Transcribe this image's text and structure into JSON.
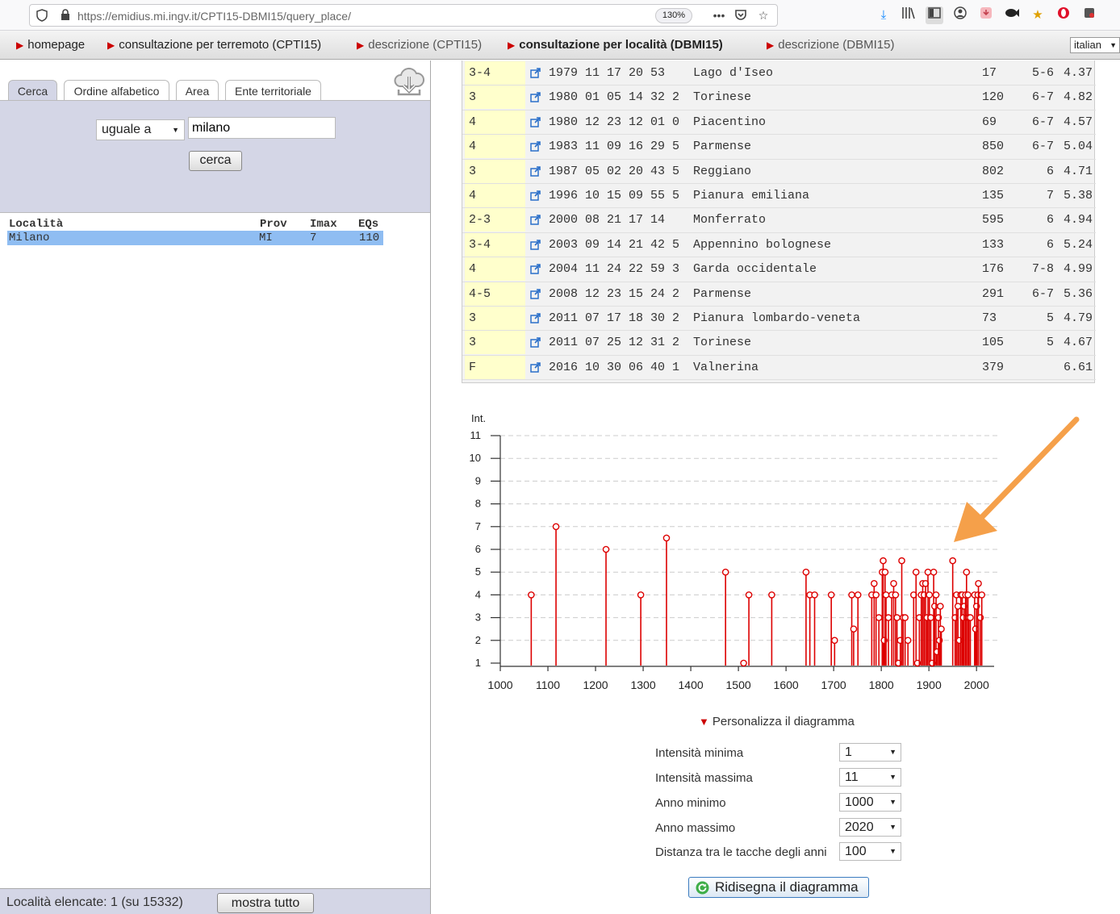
{
  "browser": {
    "url": "https://emidius.mi.ingv.it/CPTI15-DBMI15/query_place/",
    "zoom": "130%"
  },
  "nav": {
    "items": [
      {
        "label": "homepage"
      },
      {
        "label": "consultazione per terremoto (CPTI15)"
      },
      {
        "label": "descrizione (CPTI15)"
      },
      {
        "label": "consultazione per località (DBMI15)"
      },
      {
        "label": "descrizione (DBMI15)"
      }
    ],
    "language": "italian"
  },
  "tabs": [
    "Cerca",
    "Ordine alfabetico",
    "Area",
    "Ente territoriale"
  ],
  "search": {
    "match_mode": "uguale a",
    "query": "milano",
    "button": "cerca"
  },
  "locations": {
    "headers": [
      "Località",
      "Prov",
      "Imax",
      "EQs"
    ],
    "rows": [
      {
        "name": "Milano",
        "prov": "MI",
        "imax": "7",
        "eqs": "110"
      }
    ]
  },
  "footer": {
    "count_text": "Località elencate: 1 (su 15332)",
    "show_all": "mostra tutto"
  },
  "events": [
    {
      "int": "3-4",
      "date": "1979 11 17 20 53  ",
      "area": "Lago d'Iseo",
      "np": "17",
      "io": "5-6",
      "mw": "4.37"
    },
    {
      "int": "3",
      "date": "1980 01 05 14 32 2",
      "area": "Torinese",
      "np": "120",
      "io": "6-7",
      "mw": "4.82"
    },
    {
      "int": "4",
      "date": "1980 12 23 12 01 0",
      "area": "Piacentino",
      "np": "69",
      "io": "6-7",
      "mw": "4.57"
    },
    {
      "int": "4",
      "date": "1983 11 09 16 29 5",
      "area": "Parmense",
      "np": "850",
      "io": "6-7",
      "mw": "5.04"
    },
    {
      "int": "3",
      "date": "1987 05 02 20 43 5",
      "area": "Reggiano",
      "np": "802",
      "io": "6",
      "mw": "4.71"
    },
    {
      "int": "4",
      "date": "1996 10 15 09 55 5",
      "area": "Pianura emiliana",
      "np": "135",
      "io": "7",
      "mw": "5.38"
    },
    {
      "int": "2-3",
      "date": "2000 08 21 17 14  ",
      "area": "Monferrato",
      "np": "595",
      "io": "6",
      "mw": "4.94"
    },
    {
      "int": "3-4",
      "date": "2003 09 14 21 42 5",
      "area": "Appennino bolognese",
      "np": "133",
      "io": "6",
      "mw": "5.24"
    },
    {
      "int": "4",
      "date": "2004 11 24 22 59 3",
      "area": "Garda occidentale",
      "np": "176",
      "io": "7-8",
      "mw": "4.99"
    },
    {
      "int": "4-5",
      "date": "2008 12 23 15 24 2",
      "area": "Parmense",
      "np": "291",
      "io": "6-7",
      "mw": "5.36"
    },
    {
      "int": "3",
      "date": "2011 07 17 18 30 2",
      "area": "Pianura lombardo-veneta",
      "np": "73",
      "io": "5",
      "mw": "4.79"
    },
    {
      "int": "3",
      "date": "2011 07 25 12 31 2",
      "area": "Torinese",
      "np": "105",
      "io": "5",
      "mw": "4.67"
    },
    {
      "int": "F",
      "date": "2016 10 30 06 40 1",
      "area": "Valnerina",
      "np": "379",
      "io": "",
      "mw": "6.61"
    }
  ],
  "chart_data": {
    "type": "scatter",
    "ylabel": "Int.",
    "xlim": [
      1000,
      2020
    ],
    "ylim": [
      1,
      11
    ],
    "x_ticks": [
      1000,
      1100,
      1200,
      1300,
      1400,
      1500,
      1600,
      1700,
      1800,
      1900,
      2000
    ],
    "y_ticks": [
      1,
      2,
      3,
      4,
      5,
      6,
      7,
      8,
      9,
      10,
      11
    ],
    "grid": "horizontal dashed",
    "stem_color": "#dd0000",
    "points": [
      [
        1065,
        4
      ],
      [
        1117,
        7
      ],
      [
        1222,
        6
      ],
      [
        1295,
        4
      ],
      [
        1349,
        6.5
      ],
      [
        1473,
        5
      ],
      [
        1511,
        1
      ],
      [
        1522,
        4
      ],
      [
        1570,
        4
      ],
      [
        1642,
        5
      ],
      [
        1650,
        4
      ],
      [
        1660,
        4
      ],
      [
        1695,
        4
      ],
      [
        1702,
        2
      ],
      [
        1738,
        4
      ],
      [
        1742,
        2.5
      ],
      [
        1751,
        4
      ],
      [
        1780,
        4
      ],
      [
        1785,
        4.5
      ],
      [
        1789,
        4
      ],
      [
        1795,
        3
      ],
      [
        1802,
        5
      ],
      [
        1804,
        5.5
      ],
      [
        1806,
        2
      ],
      [
        1808,
        5
      ],
      [
        1810,
        4
      ],
      [
        1815,
        3
      ],
      [
        1822,
        4
      ],
      [
        1826,
        4.5
      ],
      [
        1830,
        4
      ],
      [
        1833,
        3
      ],
      [
        1836,
        1
      ],
      [
        1840,
        2
      ],
      [
        1843,
        5.5
      ],
      [
        1846,
        3
      ],
      [
        1850,
        3
      ],
      [
        1856,
        2
      ],
      [
        1868,
        4
      ],
      [
        1873,
        5
      ],
      [
        1876,
        1
      ],
      [
        1880,
        3
      ],
      [
        1884,
        4
      ],
      [
        1887,
        4.5
      ],
      [
        1890,
        4
      ],
      [
        1893,
        4.5
      ],
      [
        1896,
        3
      ],
      [
        1898,
        5
      ],
      [
        1901,
        4
      ],
      [
        1904,
        3
      ],
      [
        1907,
        1
      ],
      [
        1910,
        5
      ],
      [
        1912,
        3.5
      ],
      [
        1915,
        4
      ],
      [
        1917,
        1.5
      ],
      [
        1920,
        3
      ],
      [
        1922,
        2
      ],
      [
        1924,
        3.5
      ],
      [
        1926,
        2.5
      ],
      [
        1950,
        5.5
      ],
      [
        1955,
        3
      ],
      [
        1958,
        4
      ],
      [
        1961,
        3.5
      ],
      [
        1964,
        2
      ],
      [
        1967,
        4
      ],
      [
        1970,
        4
      ],
      [
        1972,
        3
      ],
      [
        1974,
        3.5
      ],
      [
        1977,
        4
      ],
      [
        1979,
        5
      ],
      [
        1982,
        4
      ],
      [
        1984,
        3
      ],
      [
        1987,
        3
      ],
      [
        1996,
        4
      ],
      [
        1998,
        2.5
      ],
      [
        2000,
        3.5
      ],
      [
        2003,
        4
      ],
      [
        2004,
        4.5
      ],
      [
        2008,
        3
      ],
      [
        2011,
        4
      ]
    ]
  },
  "customize": {
    "toggle": "Personalizza il diagramma",
    "fields": [
      {
        "label": "Intensità minima",
        "value": "1"
      },
      {
        "label": "Intensità massima",
        "value": "11"
      },
      {
        "label": "Anno minimo",
        "value": "1000"
      },
      {
        "label": "Anno massimo",
        "value": "2020"
      },
      {
        "label": "Distanza tra le tacche degli anni",
        "value": "100"
      }
    ],
    "redraw": "Ridisegna il diagramma"
  },
  "colors": {
    "accent_red": "#cc0000",
    "panel_blue": "#d4d6e6",
    "selected_row": "#8fbdf2",
    "intensity_cell": "#ffffcc",
    "arrow": "#f5a04a"
  }
}
